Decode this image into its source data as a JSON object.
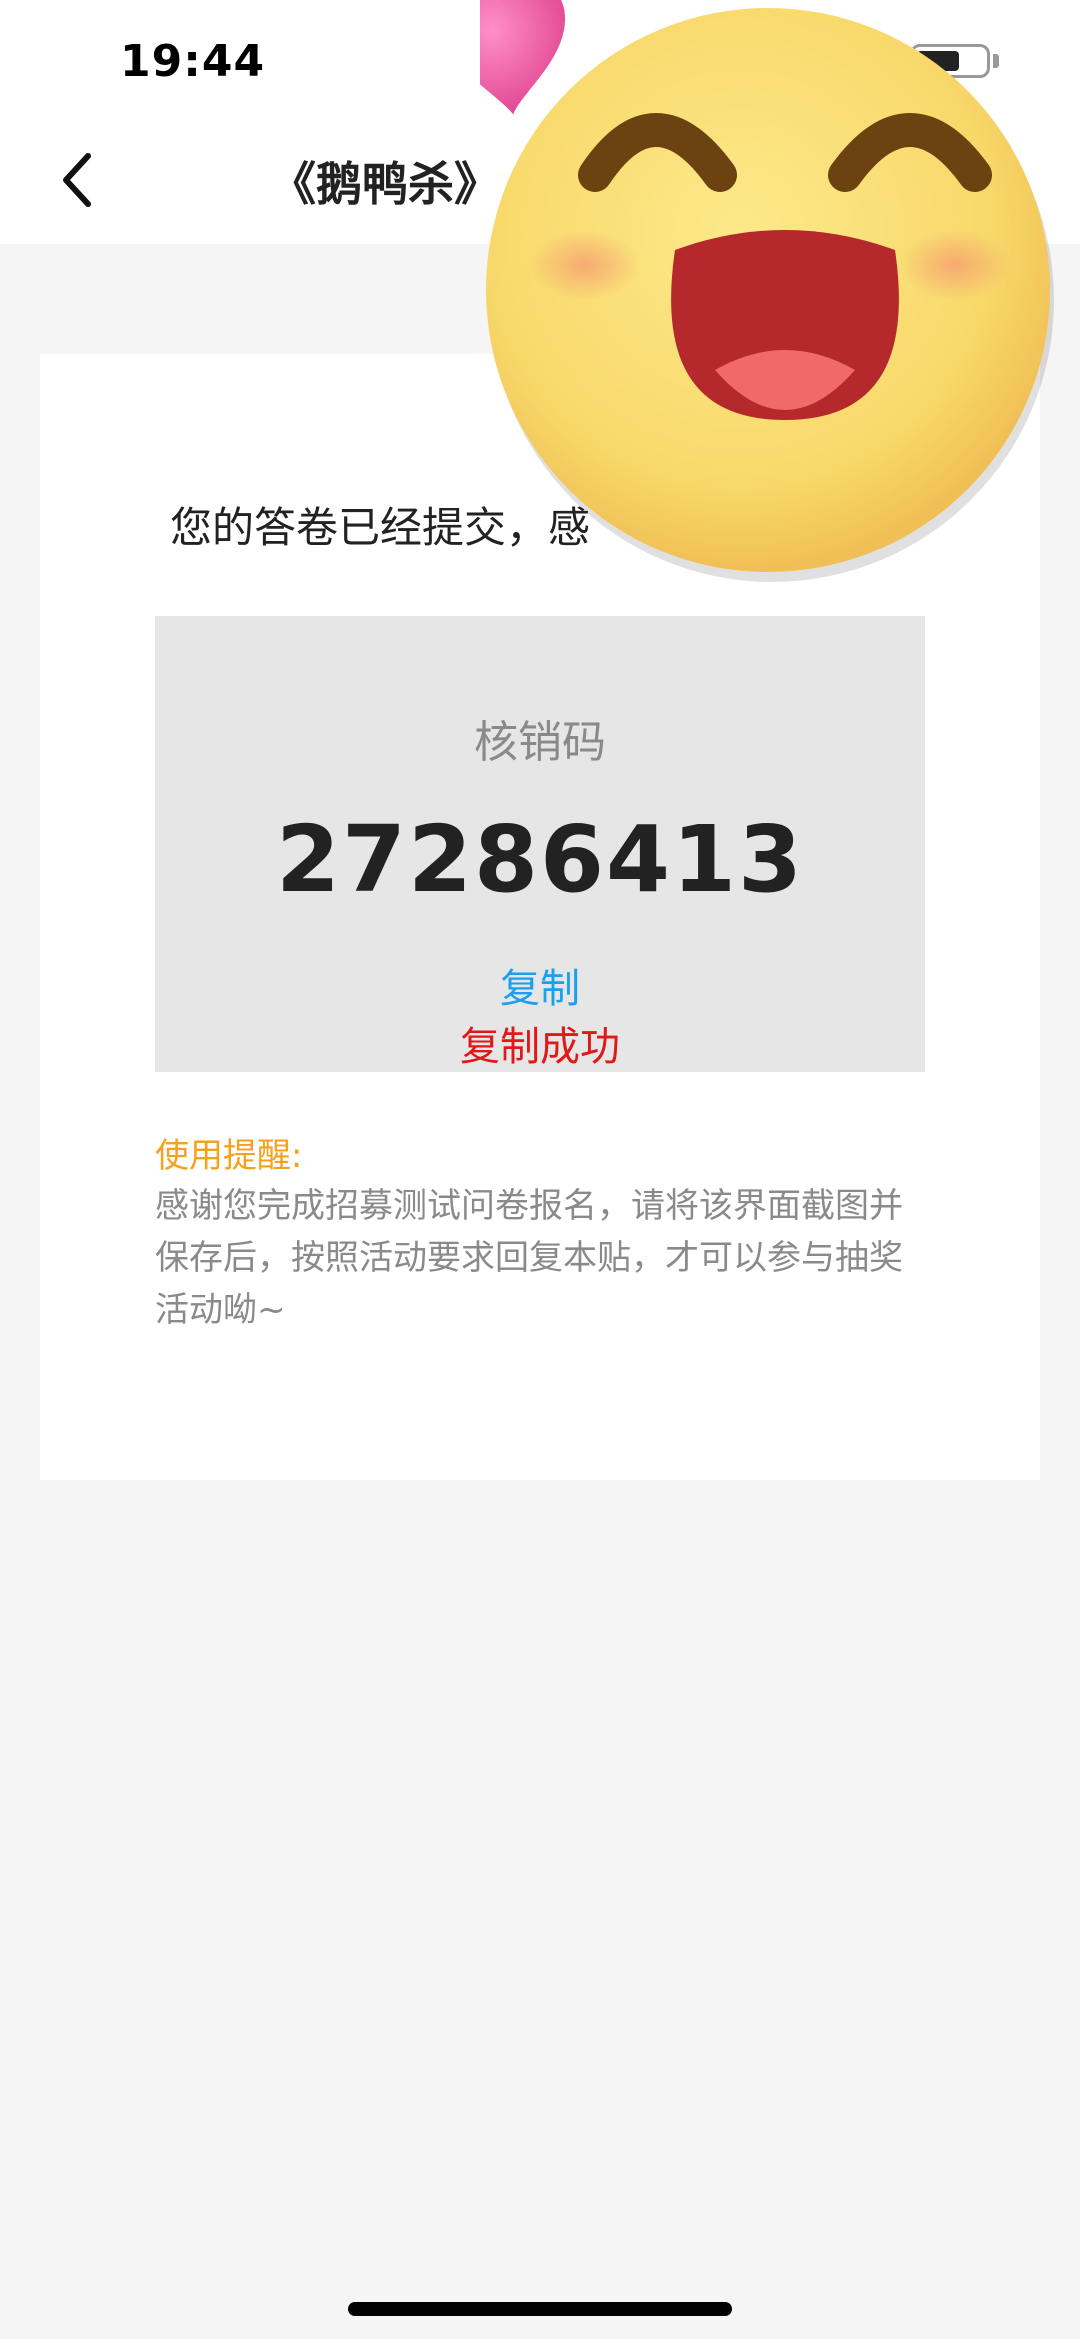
{
  "status_bar": {
    "time": "19:44"
  },
  "nav": {
    "title": "《鹅鸭杀》"
  },
  "card": {
    "submit_message": "您的答卷已经提交，感",
    "code_label": "核销码",
    "code_value": "27286413",
    "copy_label": "复制",
    "copy_success": "复制成功",
    "tip_title": "使用提醒:",
    "tip_body": "感谢您完成招募测试问卷报名，请将该界面截图并保存后，按照活动要求回复本贴，才可以参与抽奖活动呦~"
  },
  "icons": {
    "back": "chevron-left-icon",
    "emoji": "happy-face-emoji-icon",
    "heart": "heart-icon"
  },
  "colors": {
    "copy_link": "#1aa0ef",
    "copy_success": "#e01818",
    "tip_title": "#f5a11c",
    "text_gray": "#8a8a8a",
    "code_box_bg": "#e6e6e6"
  }
}
